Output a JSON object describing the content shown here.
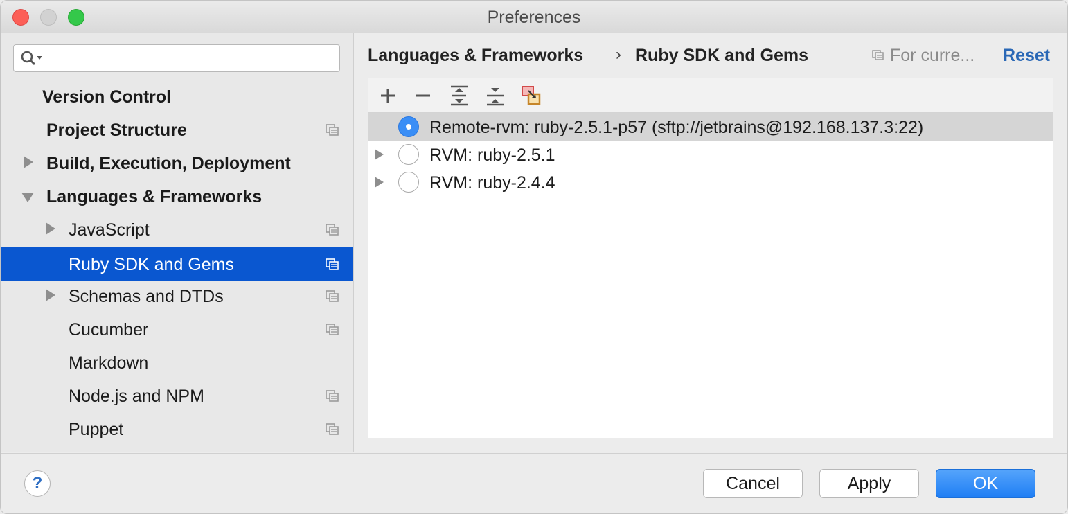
{
  "window": {
    "title": "Preferences"
  },
  "search": {
    "placeholder": "",
    "value": ""
  },
  "sidebar": {
    "items": [
      {
        "label": "Version Control"
      },
      {
        "label": "Project Structure"
      },
      {
        "label": "Build, Execution, Deployment"
      },
      {
        "label": "Languages & Frameworks"
      },
      {
        "label": "JavaScript"
      },
      {
        "label": "Ruby SDK and Gems"
      },
      {
        "label": "Schemas and DTDs"
      },
      {
        "label": "Cucumber"
      },
      {
        "label": "Markdown"
      },
      {
        "label": "Node.js and NPM"
      },
      {
        "label": "Puppet"
      }
    ],
    "selected": "Ruby SDK and Gems"
  },
  "header": {
    "breadcrumb_parent": "Languages & Frameworks",
    "breadcrumb_sep": "›",
    "breadcrumb_current": "Ruby SDK and Gems",
    "scope_label": "For curre...",
    "reset_label": "Reset"
  },
  "toolbar": {
    "icons": [
      "add-icon",
      "remove-icon",
      "expand-all-icon",
      "collapse-all-icon",
      "attach-gem-icon"
    ]
  },
  "sdks": [
    {
      "label": "Remote-rvm: ruby-2.5.1-p57 (sftp://jetbrains@192.168.137.3:22)",
      "selected": true
    },
    {
      "label": "RVM: ruby-2.5.1",
      "selected": false
    },
    {
      "label": "RVM: ruby-2.4.4",
      "selected": false
    }
  ],
  "footer": {
    "help_label": "?",
    "cancel_label": "Cancel",
    "apply_label": "Apply",
    "ok_label": "OK"
  },
  "colors": {
    "selection": "#0a57d0",
    "accent": "#2a68b6",
    "primary_button": "#1f7ef4"
  }
}
